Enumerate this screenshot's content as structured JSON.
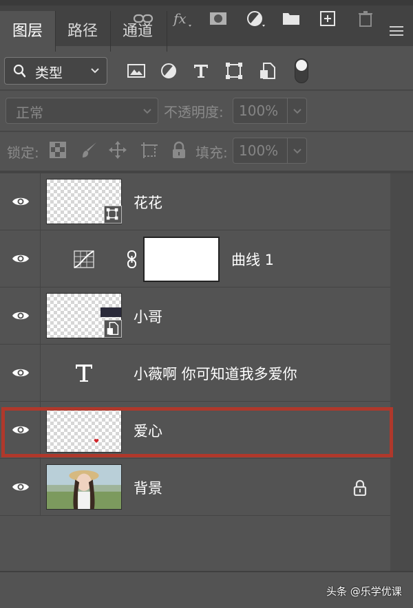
{
  "tabs": [
    {
      "label": "图层",
      "active": true
    },
    {
      "label": "路径",
      "active": false
    },
    {
      "label": "通道",
      "active": false
    }
  ],
  "filter": {
    "label": "类型"
  },
  "blend_mode": {
    "label": "正常"
  },
  "opacity": {
    "label": "不透明度:",
    "value": "100%"
  },
  "lock": {
    "label": "锁定:"
  },
  "fill": {
    "label": "填充:",
    "value": "100%"
  },
  "layers": [
    {
      "name": "花花",
      "type": "smart-object",
      "visible": true
    },
    {
      "name": "曲线 1",
      "type": "adjustment-curves",
      "visible": true
    },
    {
      "name": "小哥",
      "type": "smart-object",
      "visible": true
    },
    {
      "name": "小薇啊 你可知道我多爱你",
      "type": "text",
      "visible": true
    },
    {
      "name": "爱心",
      "type": "pixel",
      "visible": true,
      "highlighted": true
    },
    {
      "name": "背景",
      "type": "background",
      "visible": true,
      "locked": true
    }
  ],
  "colors": {
    "highlight": "#b0382b",
    "panel": "#535353"
  },
  "watermark": "头条 @乐学优课"
}
